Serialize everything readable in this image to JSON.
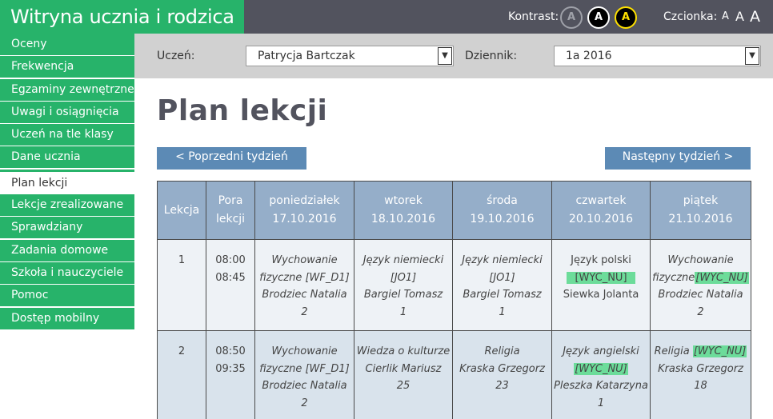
{
  "app": {
    "title": "Witryna ucznia i rodzica"
  },
  "topbar": {
    "contrast_label": "Kontrast:",
    "contrast_buttons": [
      "A",
      "A",
      "A"
    ],
    "font_label": "Czcionka:",
    "font_buttons": [
      "A",
      "A",
      "A"
    ]
  },
  "sidebar": {
    "items": [
      {
        "label": "Oceny"
      },
      {
        "label": "Frekwencja"
      },
      {
        "label": "Egzaminy zewnętrzne"
      },
      {
        "label": "Uwagi i osiągnięcia"
      },
      {
        "label": "Uczeń na tle klasy"
      },
      {
        "label": "Dane ucznia"
      },
      {
        "label": "Plan lekcji",
        "active": true
      },
      {
        "label": "Lekcje zrealizowane"
      },
      {
        "label": "Sprawdziany"
      },
      {
        "label": "Zadania domowe"
      },
      {
        "label": "Szkoła i nauczyciele"
      },
      {
        "label": "Pomoc"
      },
      {
        "label": "Dostęp mobilny"
      }
    ]
  },
  "filters": {
    "student_label": "Uczeń:",
    "student_value": "Patrycja Bartczak",
    "journal_label": "Dziennik:",
    "journal_value": "1a 2016"
  },
  "page": {
    "title": "Plan lekcji",
    "prev_week": "< Poprzedni tydzień",
    "next_week": "Następny tydzień >"
  },
  "table": {
    "col_lesson": "Lekcja",
    "col_time": [
      "Pora",
      "lekcji"
    ],
    "days": [
      {
        "name": "poniedziałek",
        "date": "17.10.2016"
      },
      {
        "name": "wtorek",
        "date": "18.10.2016"
      },
      {
        "name": "środa",
        "date": "19.10.2016"
      },
      {
        "name": "czwartek",
        "date": "20.10.2016"
      },
      {
        "name": "piątek",
        "date": "21.10.2016"
      }
    ],
    "rows": [
      {
        "number": "1",
        "start": "08:00",
        "end": "08:45",
        "cells": [
          {
            "subject": "Wychowanie fizyczne [WF_D1]",
            "teacher": "Brodziec Natalia",
            "room": "2"
          },
          {
            "subject": "Język niemiecki [JO1]",
            "teacher": "Bargiel Tomasz",
            "room": "1"
          },
          {
            "subject": "Język niemiecki [JO1]",
            "teacher": "Bargiel Tomasz",
            "room": "1"
          },
          {
            "subject": "Język polski",
            "tag": "[WYC_NU]",
            "teacher": "Siewka Jolanta"
          },
          {
            "subject": "Wychowanie fizyczne",
            "tag": "[WYC_NU]",
            "teacher": "Brodziec Natalia",
            "room": "2"
          }
        ]
      },
      {
        "number": "2",
        "start": "08:50",
        "end": "09:35",
        "cells": [
          {
            "subject": "Wychowanie fizyczne [WF_D1]",
            "teacher": "Brodziec Natalia",
            "room": "2"
          },
          {
            "subject": "Wiedza o kulturze",
            "teacher": "Cierlik Mariusz",
            "room": "25"
          },
          {
            "subject": "Religia",
            "teacher": "Kraska Grzegorz",
            "room": "23"
          },
          {
            "subject": "Język angielski",
            "tag": "[WYC_NU]",
            "teacher": "Pleszka Katarzyna",
            "room": "1"
          },
          {
            "subject": "Religia",
            "tag": "[WYC_NU]",
            "teacher": "Kraska Grzegorz",
            "room": "18"
          }
        ]
      }
    ]
  }
}
